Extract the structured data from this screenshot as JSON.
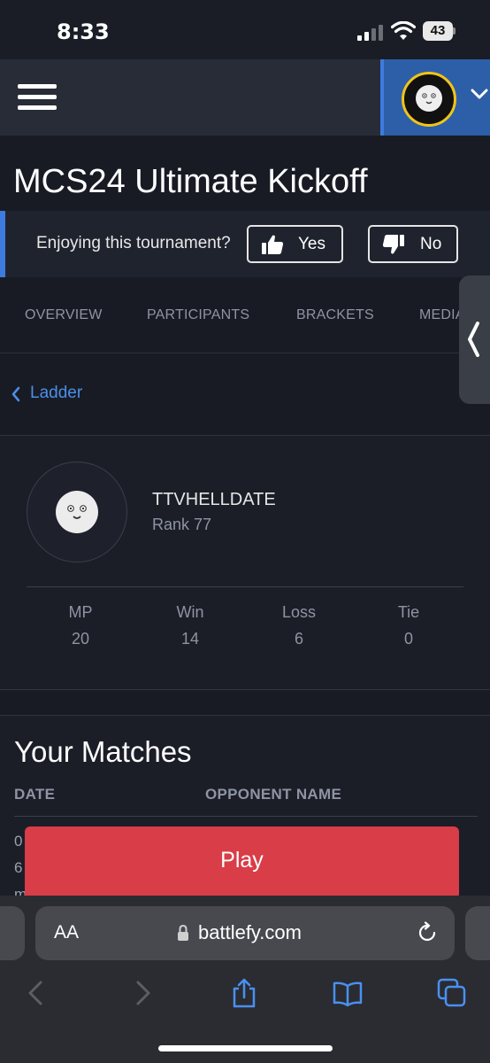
{
  "status_bar": {
    "time": "8:33",
    "battery": "43"
  },
  "nav": {
    "menu_icon": "hamburger-icon",
    "profile_icon": "avatar-icon",
    "dropdown_icon": "chevron-down-icon"
  },
  "page": {
    "title": "MCS24 Ultimate Kickoff"
  },
  "feedback": {
    "question": "Enjoying this tournament?",
    "yes_label": "Yes",
    "no_label": "No"
  },
  "tabs": [
    {
      "label": "OVERVIEW"
    },
    {
      "label": "PARTICIPANTS"
    },
    {
      "label": "BRACKETS"
    },
    {
      "label": "MEDIA"
    }
  ],
  "back_link": {
    "label": "Ladder"
  },
  "player": {
    "name": "TTVHELLDATE",
    "rank": "Rank 77",
    "stats": [
      {
        "label": "MP",
        "value": "20"
      },
      {
        "label": "Win",
        "value": "14"
      },
      {
        "label": "Loss",
        "value": "6"
      },
      {
        "label": "Tie",
        "value": "0"
      }
    ]
  },
  "matches": {
    "title": "Your Matches",
    "columns": [
      "DATE",
      "OPPONENT NAME"
    ],
    "partial_rows": [
      "0",
      "6",
      "m"
    ]
  },
  "play_button": {
    "label": "Play"
  },
  "browser": {
    "text_size_label": "AA",
    "url": "battlefy.com"
  },
  "colors": {
    "accent": "#3d7be0",
    "play": "#d93d47",
    "link": "#4b8fe8",
    "avatar_ring": "#f0c419"
  }
}
